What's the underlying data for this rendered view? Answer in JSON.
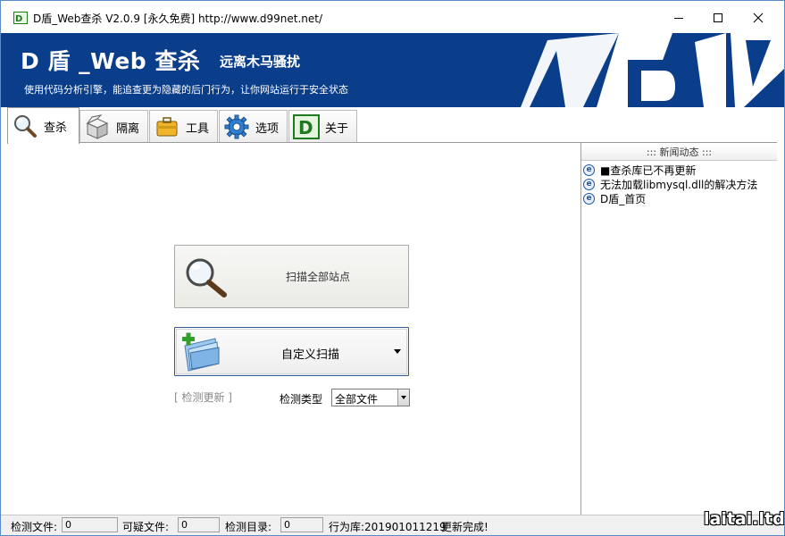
{
  "window": {
    "title": "D盾_Web查杀 V2.0.9 [永久免费] http://www.d99net.net/",
    "controls": {
      "minimize": "minimize-icon",
      "maximize": "maximize-icon",
      "close": "close-icon"
    }
  },
  "banner": {
    "logo_text": "D 盾 _Web 查杀",
    "slogan": "远离木马骚扰",
    "subtitle": "使用代码分析引擎，能追查更为隐藏的后门行为，让你网站运行于安全状态",
    "background_color": "#0b3e8a"
  },
  "tabs": [
    {
      "label": "查杀",
      "icon": "magnifier-icon",
      "active": true
    },
    {
      "label": "隔离",
      "icon": "box-icon",
      "active": false
    },
    {
      "label": "工具",
      "icon": "toolbox-icon",
      "active": false
    },
    {
      "label": "选项",
      "icon": "gear-icon",
      "active": false
    },
    {
      "label": "关于",
      "icon": "d-logo-icon",
      "active": false
    }
  ],
  "main": {
    "scan_all_label": "扫描全部站点",
    "custom_scan_label": "自定义扫描",
    "check_update": "[ 检测更新 ]",
    "detect_type_label": "检测类型",
    "detect_type_value": "全部文件"
  },
  "news": {
    "header": "::: 新闻动态 :::",
    "items": [
      "■查杀库已不再更新",
      "无法加载libmysql.dll的解决方法",
      "D盾_首页"
    ]
  },
  "statusbar": {
    "files_label": "检测文件:",
    "files_value": "0",
    "suspicious_label": "可疑文件:",
    "suspicious_value": "0",
    "dirs_label": "检测目录:",
    "dirs_value": "0",
    "rules_label": "行为库:201901011219",
    "update_status": "更新完成!"
  },
  "watermark": "laitai.ltd"
}
